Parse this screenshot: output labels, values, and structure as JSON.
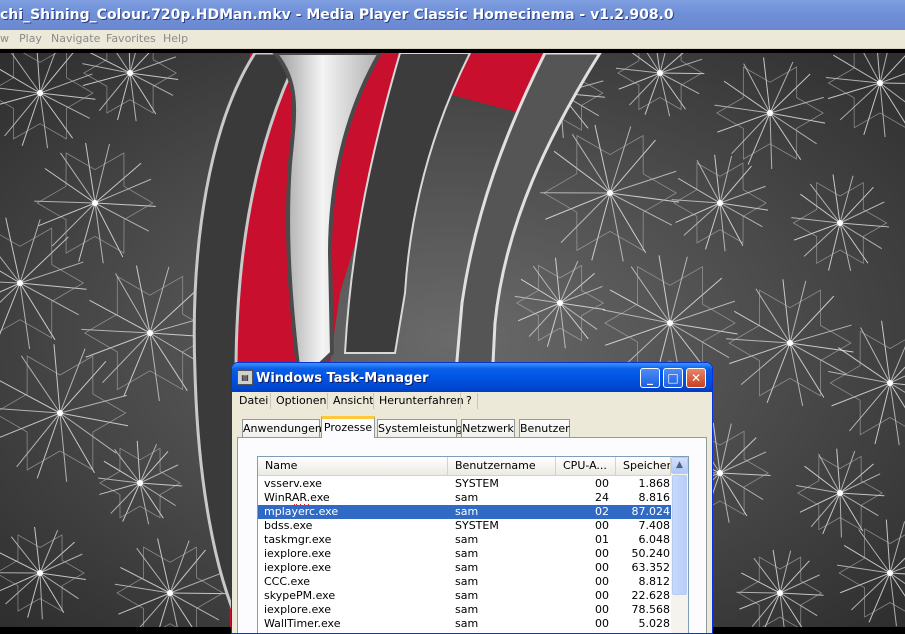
{
  "media_player": {
    "title": "chi_Shining_Colour.720p.HDMan.mkv - Media Player Classic Homecinema - v1.2.908.0",
    "menu": [
      "w",
      "Play",
      "Navigate",
      "Favorites",
      "Help"
    ]
  },
  "task_manager": {
    "title": "Windows Task-Manager",
    "buttons": {
      "minimize": "_",
      "maximize": "□",
      "close": "✕"
    },
    "menu": [
      "Datei",
      "Optionen",
      "Ansicht",
      "Herunterfahren",
      "?"
    ],
    "tabs": [
      "Anwendungen",
      "Prozesse",
      "Systemleistung",
      "Netzwerk",
      "Benutzer"
    ],
    "active_tab": "Prozesse",
    "columns": [
      "Name",
      "Benutzername",
      "CPU-A...",
      "Speicher..."
    ],
    "processes": [
      {
        "name": "vsserv.exe",
        "user": "SYSTEM",
        "cpu": "00",
        "mem": "1.868"
      },
      {
        "name": "WinRAR.exe",
        "user": "sam",
        "cpu": "24",
        "mem": "8.816"
      },
      {
        "name": "mplayerc.exe",
        "user": "sam",
        "cpu": "02",
        "mem": "87.024"
      },
      {
        "name": "bdss.exe",
        "user": "SYSTEM",
        "cpu": "00",
        "mem": "7.408"
      },
      {
        "name": "taskmgr.exe",
        "user": "sam",
        "cpu": "01",
        "mem": "6.048"
      },
      {
        "name": "iexplore.exe",
        "user": "sam",
        "cpu": "00",
        "mem": "50.240"
      },
      {
        "name": "iexplore.exe",
        "user": "sam",
        "cpu": "00",
        "mem": "63.352"
      },
      {
        "name": "CCC.exe",
        "user": "sam",
        "cpu": "00",
        "mem": "8.812"
      },
      {
        "name": "skypePM.exe",
        "user": "sam",
        "cpu": "00",
        "mem": "22.628"
      },
      {
        "name": "iexplore.exe",
        "user": "sam",
        "cpu": "00",
        "mem": "78.568"
      },
      {
        "name": "WallTimer.exe",
        "user": "sam",
        "cpu": "00",
        "mem": "5.028"
      }
    ],
    "selected_process": "mplayerc.exe"
  },
  "colors": {
    "xp_title_blue": "#0054e3",
    "selection_blue": "#316ac5",
    "accent_red": "#c8102e",
    "crystal_gray": "#6b6b6b"
  }
}
